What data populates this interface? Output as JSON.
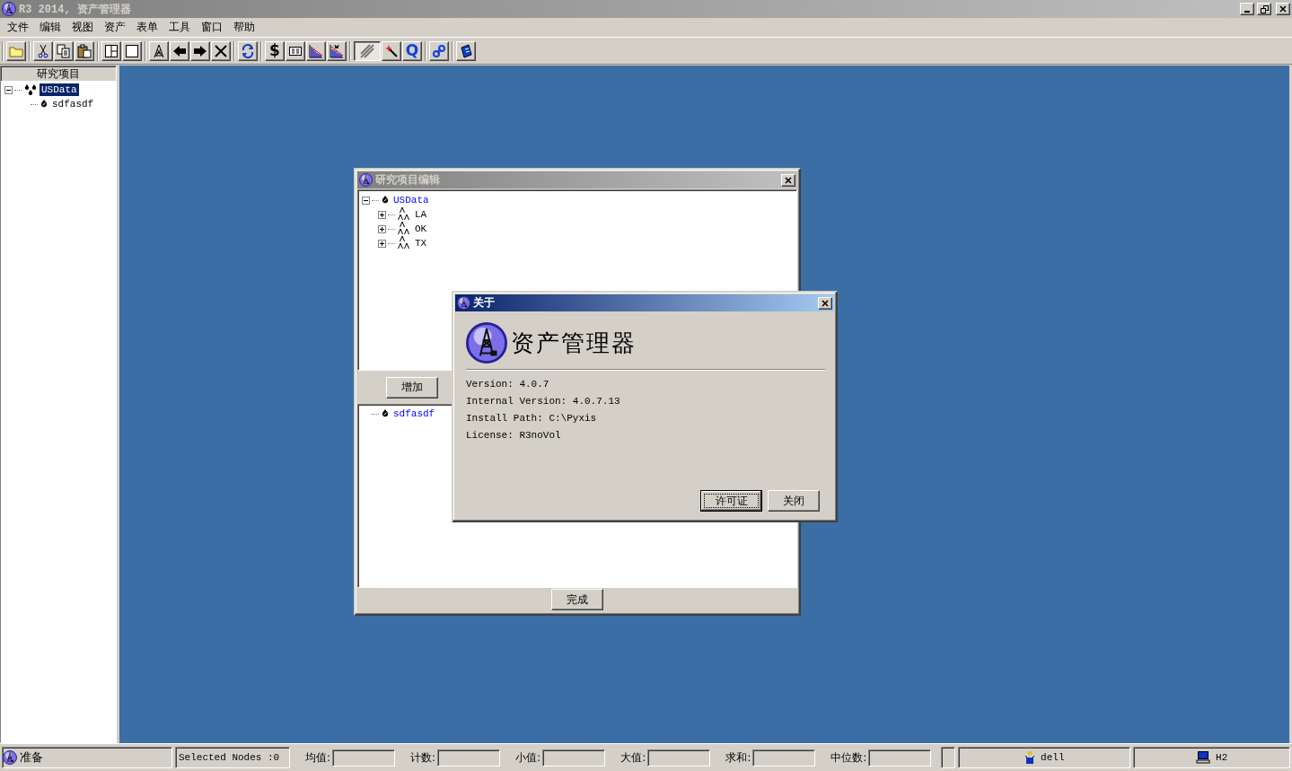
{
  "window": {
    "title": "R3 2014, 资产管理器"
  },
  "menu": [
    "文件",
    "编辑",
    "视图",
    "资产",
    "表单",
    "工具",
    "窗口",
    "帮助"
  ],
  "toolbar": [
    [
      {
        "kind": "folder",
        "pressed": false
      }
    ],
    [
      {
        "kind": "cut",
        "pressed": false
      },
      {
        "kind": "copy",
        "pressed": false
      },
      {
        "kind": "paste",
        "pressed": false
      }
    ],
    [
      {
        "kind": "split",
        "pressed": false
      },
      {
        "kind": "square",
        "pressed": false
      }
    ],
    [
      {
        "kind": "derrick",
        "pressed": false
      },
      {
        "kind": "left",
        "pressed": false
      },
      {
        "kind": "right",
        "pressed": false
      },
      {
        "kind": "delete",
        "pressed": false
      }
    ],
    [
      {
        "kind": "refresh",
        "pressed": false
      }
    ],
    [
      {
        "kind": "currency",
        "text": "$",
        "pressed": false
      },
      {
        "kind": "table",
        "pressed": false
      },
      {
        "kind": "decline",
        "pressed": false
      },
      {
        "kind": "decline2",
        "pressed": false
      }
    ],
    [
      {
        "kind": "hatch",
        "pressed": true
      },
      {
        "kind": "wand",
        "pressed": false
      },
      {
        "kind": "query",
        "text": "Q",
        "pressed": false
      }
    ],
    [
      {
        "kind": "link",
        "pressed": false
      }
    ],
    [
      {
        "kind": "book",
        "pressed": false
      }
    ]
  ],
  "project_panel": {
    "title": "研究项目",
    "tree": [
      {
        "label": "USData",
        "kind": "project",
        "selected": true,
        "highlighted": false,
        "expanded": true,
        "children": [
          {
            "label": "sdfasdf",
            "kind": "well",
            "selected": false,
            "highlighted": false
          }
        ]
      }
    ]
  },
  "edit_dialog": {
    "title": "研究项目编辑",
    "tree": [
      {
        "label": "USData",
        "kind": "well",
        "selected": false,
        "highlighted": true,
        "expanded": true,
        "children": [
          {
            "label": "LA",
            "kind": "region",
            "selected": false,
            "highlighted": false,
            "expanded": false
          },
          {
            "label": "OK",
            "kind": "region",
            "selected": false,
            "highlighted": false,
            "expanded": false
          },
          {
            "label": "TX",
            "kind": "region",
            "selected": false,
            "highlighted": false,
            "expanded": false
          }
        ]
      }
    ],
    "add_button": "增加",
    "list": [
      {
        "label": "sdfasdf",
        "kind": "well",
        "selected": false,
        "highlighted": true
      }
    ],
    "done_button": "完成"
  },
  "about_dialog": {
    "title": "关于",
    "product": "资产管理器",
    "info": [
      "Version: 4.0.7",
      "Internal Version: 4.0.7.13",
      "Install Path: C:\\Pyxis",
      "License: R3noVol"
    ],
    "buttons": [
      {
        "label": "许可证",
        "default": true
      },
      {
        "label": "关闭",
        "default": false
      }
    ]
  },
  "status_bar": {
    "message": "准备",
    "selection": "Selected Nodes :0",
    "stats": [
      {
        "label": "均值:"
      },
      {
        "label": "计数:"
      },
      {
        "label": "小值:"
      },
      {
        "label": "大值:"
      },
      {
        "label": "求和:"
      },
      {
        "label": "中位数:"
      }
    ],
    "user": "dell",
    "host": "H2"
  }
}
